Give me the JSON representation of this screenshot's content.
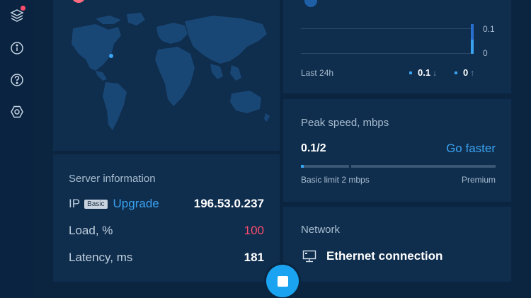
{
  "sidebar": {
    "items": [
      {
        "icon": "layers-icon",
        "has_badge": true
      },
      {
        "icon": "info-icon"
      },
      {
        "icon": "help-icon"
      },
      {
        "icon": "settings-hex-icon"
      }
    ]
  },
  "server_info": {
    "title": "Server information",
    "ip_label": "IP",
    "plan_badge": "Basic",
    "upgrade_label": "Upgrade",
    "ip_value": "196.53.0.237",
    "load_label": "Load, %",
    "load_value": "100",
    "latency_label": "Latency, ms",
    "latency_value": "181"
  },
  "traffic": {
    "tick_top": "0.1",
    "tick_bottom": "0",
    "period_label": "Last 24h",
    "download_value": "0.1",
    "download_arrow": "↓",
    "upload_value": "0",
    "upload_arrow": "↑"
  },
  "peak_speed": {
    "title": "Peak speed, mbps",
    "value": "0.1/2",
    "go_faster_label": "Go faster",
    "basic_limit_label": "Basic limit 2 mbps",
    "premium_label": "Premium",
    "fill_fraction": 0.014
  },
  "network": {
    "title": "Network",
    "connection_name": "Ethernet connection"
  },
  "colors": {
    "accent": "#3aa3f0",
    "alert": "#ff4d6d",
    "panel": "#0f2d4d",
    "background": "#0b2541"
  }
}
